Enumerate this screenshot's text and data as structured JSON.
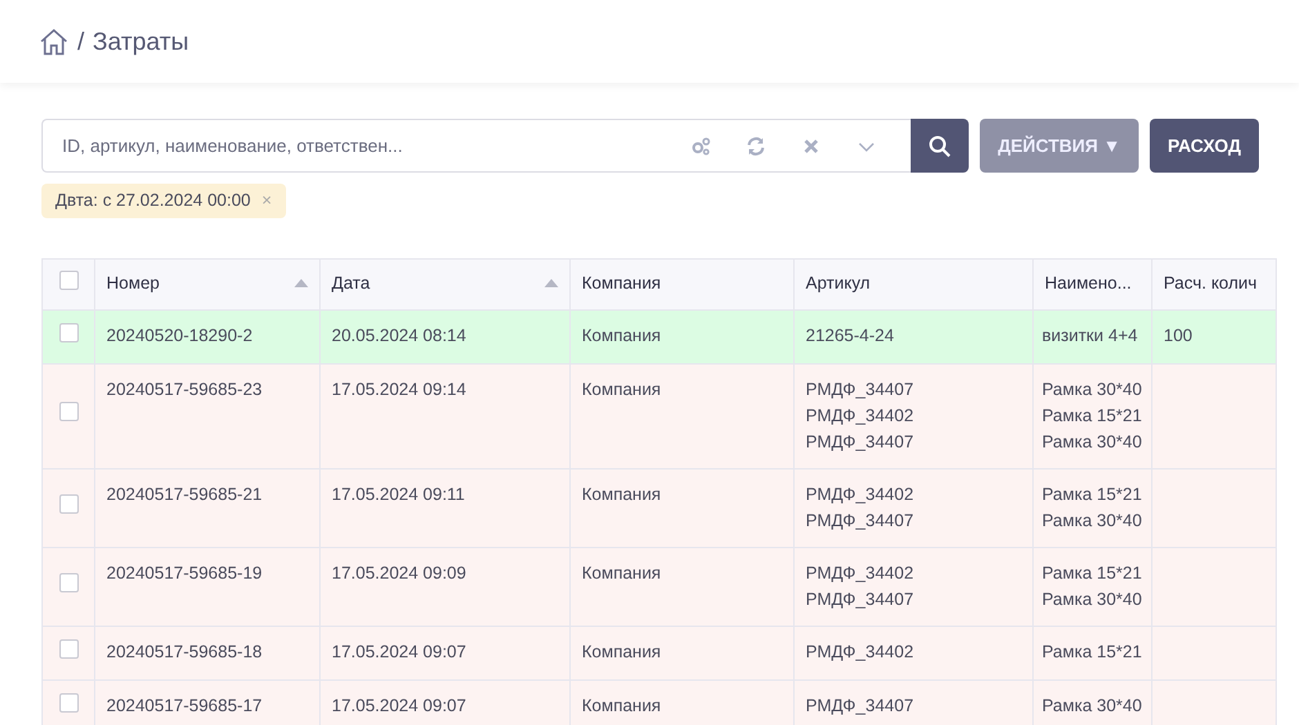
{
  "breadcrumb": {
    "separator": "/",
    "title": "Затраты"
  },
  "search": {
    "placeholder": "ID, артикул, наименование, ответствен..."
  },
  "buttons": {
    "actions": "ДЕЙСТВИЯ",
    "actions_caret": "▼",
    "expense": "РАСХОД"
  },
  "filters": [
    {
      "label": "Двта: с 27.02.2024 00:00",
      "remove": "×"
    }
  ],
  "table": {
    "columns": [
      {
        "label": "Номер",
        "sortable": true
      },
      {
        "label": "Дата",
        "sortable": true
      },
      {
        "label": "Компания",
        "sortable": false
      },
      {
        "label": "Артикул",
        "sortable": false
      },
      {
        "label": "Наимено...",
        "sortable": false
      },
      {
        "label": "Расч. колич",
        "sortable": false
      }
    ],
    "header_checked": false,
    "rows": [
      {
        "color": "#dcfce3",
        "checked": false,
        "number": "20240520-18290-2",
        "date": "20.05.2024 08:14",
        "company": "Компания",
        "articles": [
          "21265-4-24"
        ],
        "names": [
          "визитки 4+4"
        ],
        "quantity": "100"
      },
      {
        "color": "#fdf3f2",
        "checked": false,
        "number": "20240517-59685-23",
        "date": "17.05.2024 09:14",
        "company": "Компания",
        "articles": [
          "РМДФ_34407",
          "РМДФ_34402",
          "РМДФ_34407"
        ],
        "names": [
          "Рамка 30*40",
          "Рамка 15*21",
          "Рамка 30*40"
        ]
      },
      {
        "color": "#fdf3f2",
        "checked": false,
        "number": "20240517-59685-21",
        "date": "17.05.2024 09:11",
        "company": "Компания",
        "articles": [
          "РМДФ_34402",
          "РМДФ_34407"
        ],
        "names": [
          "Рамка 15*21",
          "Рамка 30*40"
        ]
      },
      {
        "color": "#fdf3f2",
        "checked": false,
        "number": "20240517-59685-19",
        "date": "17.05.2024 09:09",
        "company": "Компания",
        "articles": [
          "РМДФ_34402",
          "РМДФ_34407"
        ],
        "names": [
          "Рамка 15*21",
          "Рамка 30*40"
        ]
      },
      {
        "color": "#fdf3f2",
        "checked": false,
        "number": "20240517-59685-18",
        "date": "17.05.2024 09:07",
        "company": "Компания",
        "articles": [
          "РМДФ_34402"
        ],
        "names": [
          "Рамка 15*21"
        ]
      },
      {
        "color": "#fdf3f2",
        "checked": false,
        "number": "20240517-59685-17",
        "date": "17.05.2024 09:07",
        "company": "Компания",
        "articles": [
          "РМДФ_34407"
        ],
        "names": [
          "Рамка 30*40"
        ]
      }
    ]
  }
}
